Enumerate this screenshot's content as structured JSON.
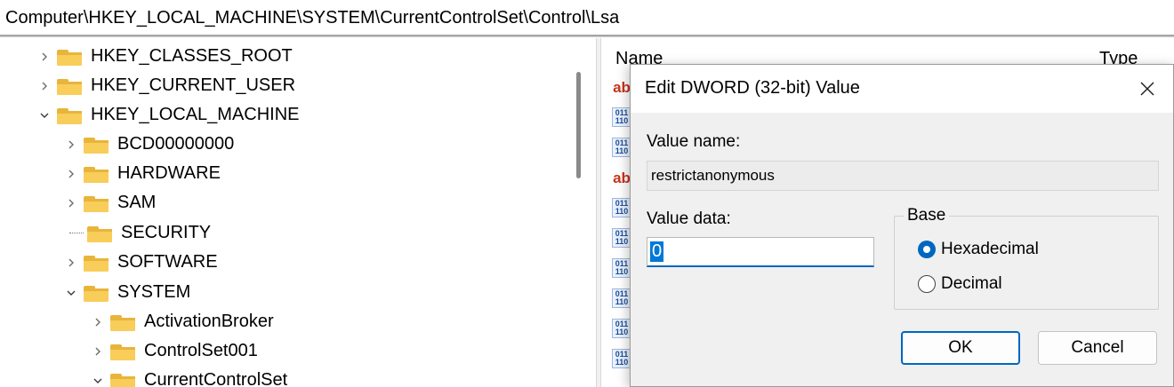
{
  "address": "Computer\\HKEY_LOCAL_MACHINE\\SYSTEM\\CurrentControlSet\\Control\\Lsa",
  "tree": {
    "hkcr": "HKEY_CLASSES_ROOT",
    "hkcu": "HKEY_CURRENT_USER",
    "hklm": "HKEY_LOCAL_MACHINE",
    "bcd": "BCD00000000",
    "hardware": "HARDWARE",
    "sam": "SAM",
    "security": "SECURITY",
    "software": "SOFTWARE",
    "system": "SYSTEM",
    "activation_broker": "ActivationBroker",
    "controlset001": "ControlSet001",
    "current_control_set": "CurrentControlSet"
  },
  "list": {
    "header_name": "Name",
    "header_type": "Type",
    "icons": [
      "string-value-icon",
      "binary-value-icon",
      "binary-value-icon",
      "string-value-icon",
      "binary-value-icon",
      "binary-value-icon",
      "binary-value-icon",
      "binary-value-icon",
      "binary-value-icon",
      "binary-value-icon"
    ]
  },
  "dialog": {
    "title": "Edit DWORD (32-bit) Value",
    "value_name_label": "Value name:",
    "value_name": "restrictanonymous",
    "value_data_label": "Value data:",
    "value_data": "0",
    "base_label": "Base",
    "hex_label": "Hexadecimal",
    "dec_label": "Decimal",
    "base_selected": "Hexadecimal",
    "ok_label": "OK",
    "cancel_label": "Cancel"
  },
  "colors": {
    "accent": "#0067c0",
    "folder": "#f8cd5a",
    "dialog_bg": "#f0f0f0"
  }
}
